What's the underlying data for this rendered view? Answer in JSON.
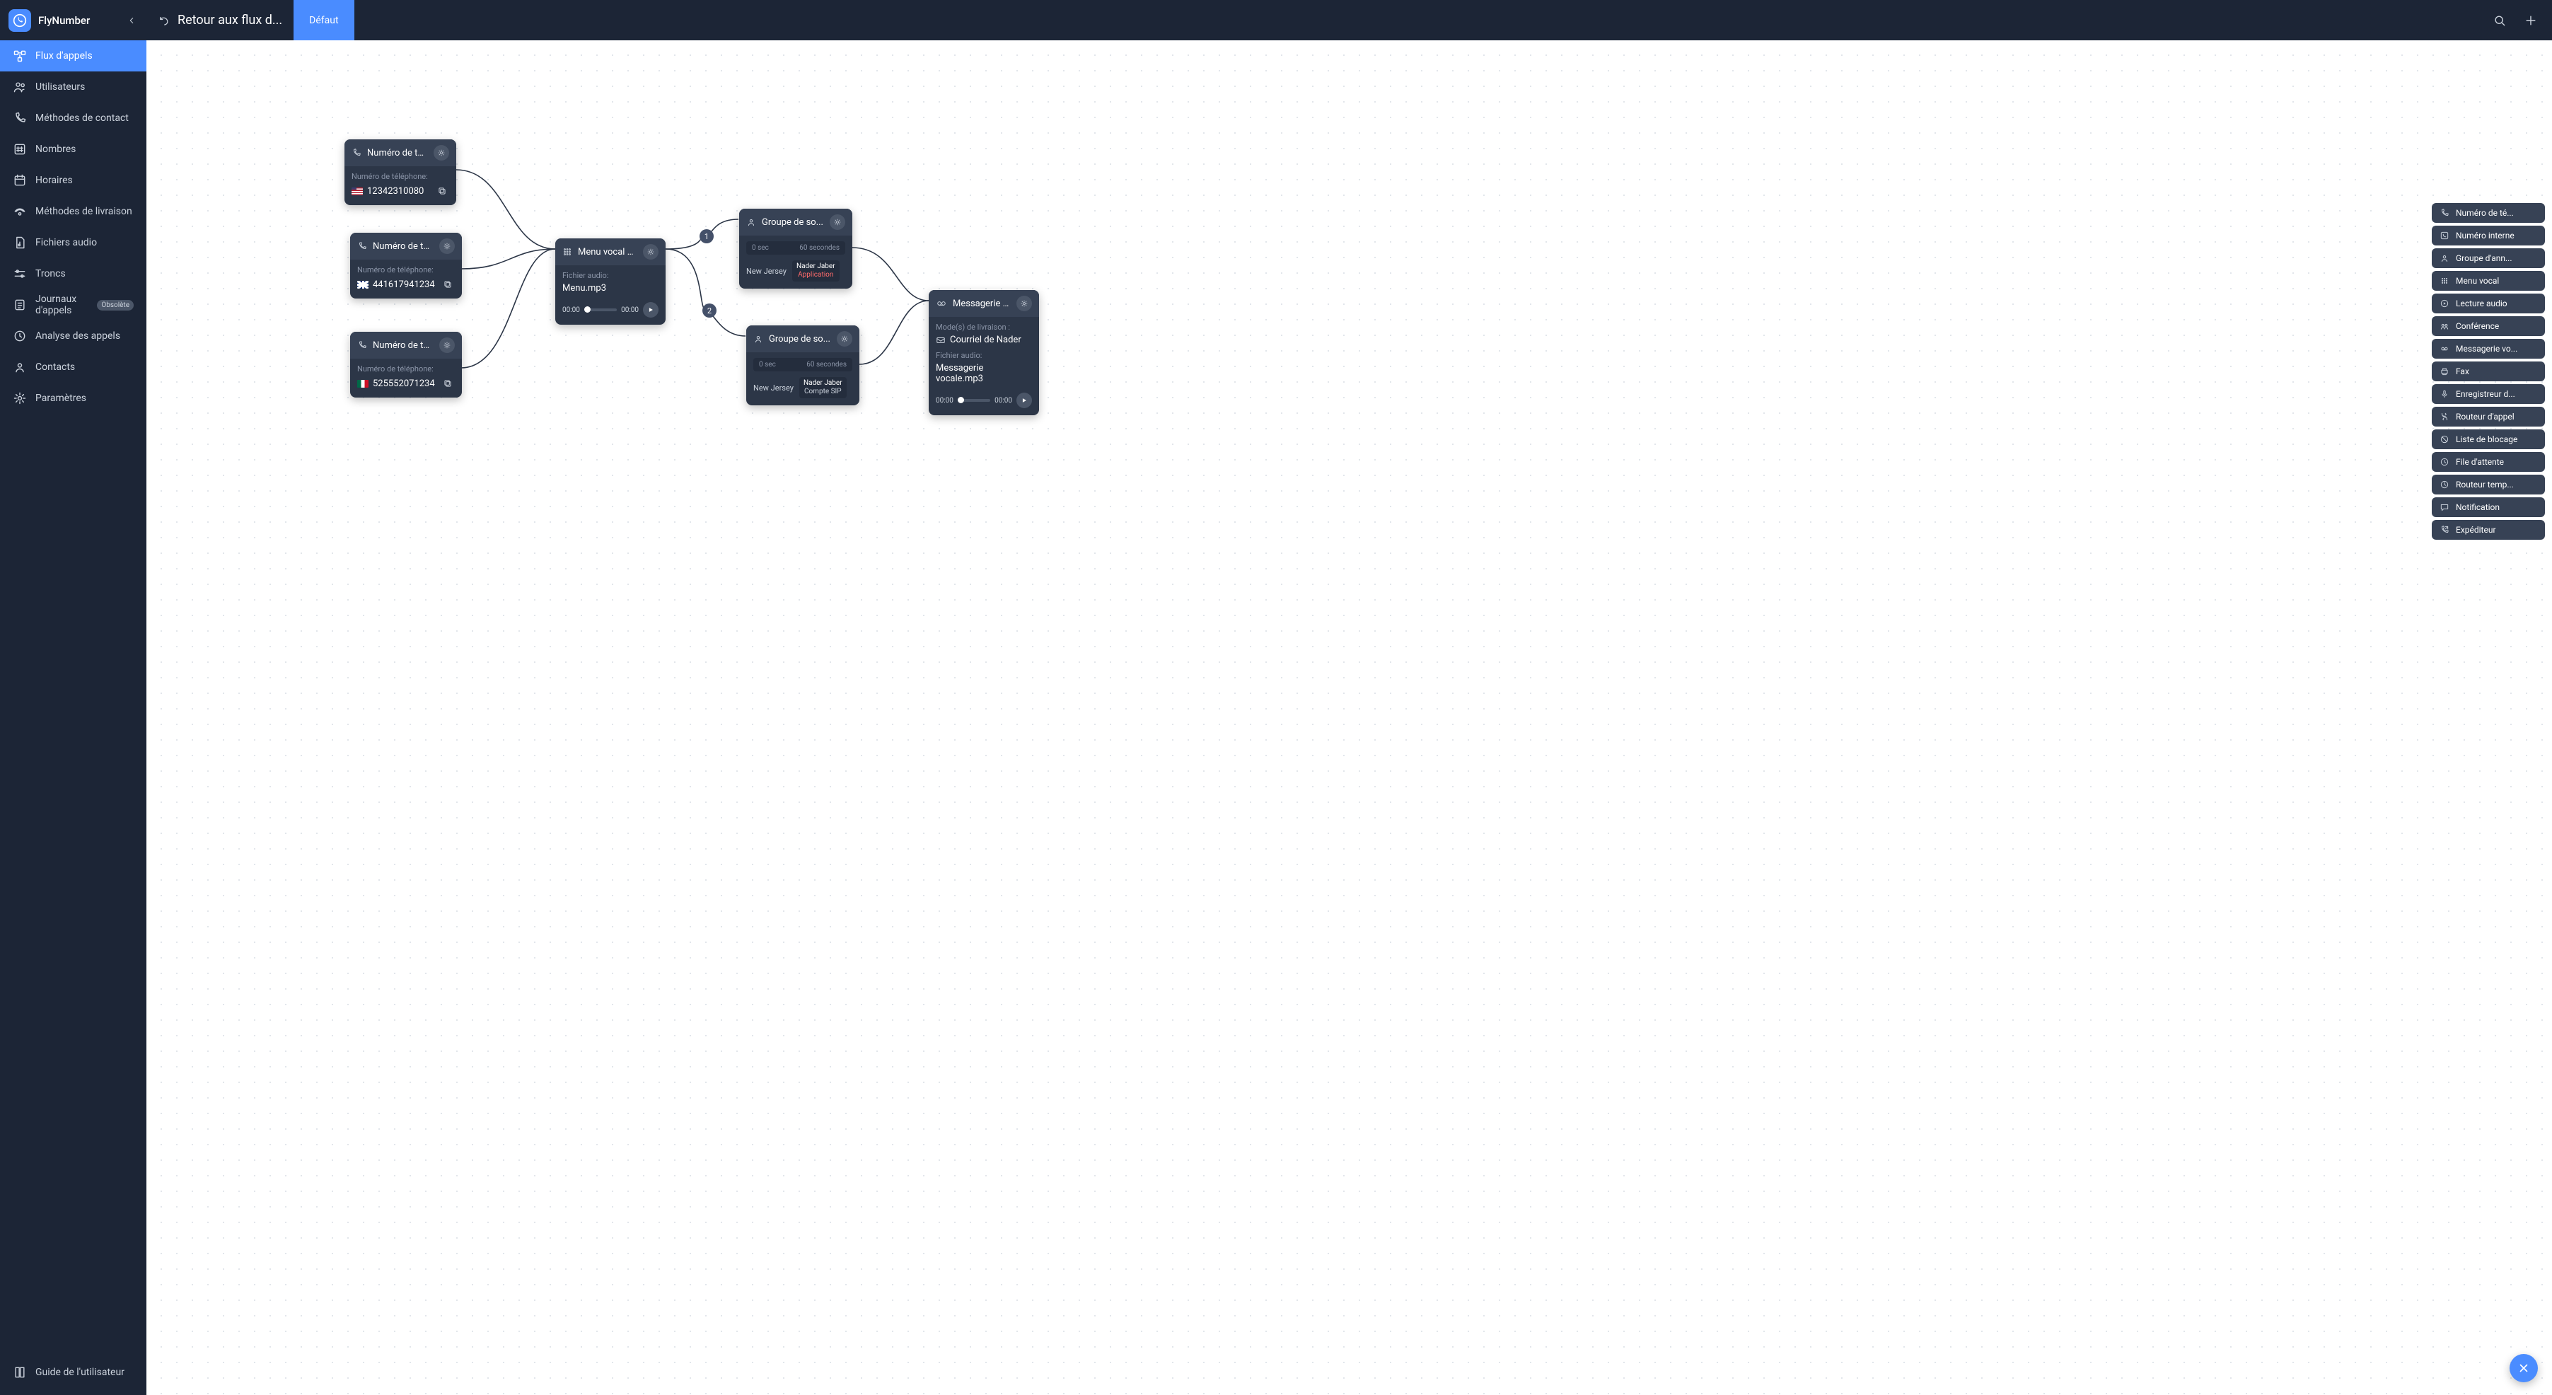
{
  "brand": "FlyNumber",
  "sidebar": {
    "items": [
      {
        "label": "Flux d'appels"
      },
      {
        "label": "Utilisateurs"
      },
      {
        "label": "Méthodes de contact"
      },
      {
        "label": "Nombres"
      },
      {
        "label": "Horaires"
      },
      {
        "label": "Méthodes de livraison"
      },
      {
        "label": "Fichiers audio"
      },
      {
        "label": "Troncs"
      },
      {
        "label": "Journaux d'appels"
      },
      {
        "label": "Analyse des appels"
      },
      {
        "label": "Contacts"
      },
      {
        "label": "Paramètres"
      }
    ],
    "badge_obsolete": "Obsolète",
    "footer": {
      "label": "Guide de l'utilisateur"
    }
  },
  "topbar": {
    "back": "Retour aux flux d...",
    "tab": "Défaut"
  },
  "nodes": {
    "phone_label": "Numéro de téléphone:",
    "phone_title": "Numéro de té...",
    "phone1": "12342310080",
    "phone2": "441617941234",
    "phone3": "525552071234",
    "ivr_title": "Menu vocal p...",
    "audio_label": "Fichier audio:",
    "ivr_file": "Menu.mp3",
    "time0": "00:00",
    "ring_title": "Groupe de so...",
    "ring_t0": "0 sec",
    "ring_t1": "60 secondes",
    "ring_loc": "New Jersey",
    "ring1_user": "Nader Jaber",
    "ring1_sub": "Application",
    "ring2_user": "Nader Jaber",
    "ring2_sub": "Compte SIP",
    "vm_title": "Messagerie vo...",
    "vm_mode": "Mode(s) de livraison :",
    "vm_mail": "Courriel de Nader",
    "vm_file": "Messagerie vocale.mp3",
    "badge1": "1",
    "badge2": "2"
  },
  "palette": [
    "Numéro de té...",
    "Numéro interne",
    "Groupe d'ann...",
    "Menu vocal",
    "Lecture audio",
    "Conférence",
    "Messagerie vo...",
    "Fax",
    "Enregistreur d...",
    "Routeur d'appel",
    "Liste de blocage",
    "File d'attente",
    "Routeur temp...",
    "Notification",
    "Expéditeur"
  ]
}
